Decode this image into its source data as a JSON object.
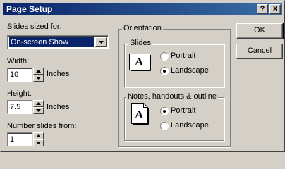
{
  "window": {
    "title": "Page Setup",
    "help_label": "?",
    "close_label": "X"
  },
  "slides_sized_for": {
    "label": "Slides sized for:",
    "value": "On-screen Show"
  },
  "width": {
    "label": "Width:",
    "value": "10",
    "unit": "Inches"
  },
  "height": {
    "label": "Height:",
    "value": "7.5",
    "unit": "Inches"
  },
  "number_from": {
    "label": "Number slides from:",
    "value": "1"
  },
  "orientation": {
    "label": "Orientation",
    "slides": {
      "label": "Slides",
      "icon_letter": "A",
      "portrait": "Portrait",
      "landscape": "Landscape",
      "selected": "Landscape"
    },
    "notes": {
      "label": "Notes, handouts & outline",
      "icon_letter": "A",
      "portrait": "Portrait",
      "landscape": "Landscape",
      "selected": "Portrait"
    }
  },
  "buttons": {
    "ok": "OK",
    "cancel": "Cancel"
  }
}
